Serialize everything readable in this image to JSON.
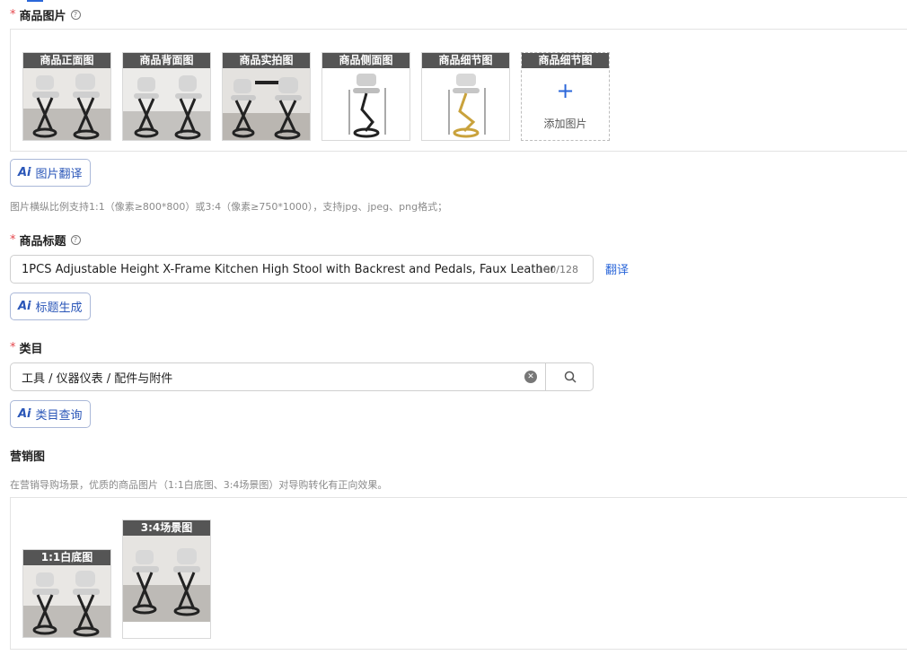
{
  "images_section": {
    "required_mark": "*",
    "label": "商品图片",
    "help_icon": "question-circle-icon",
    "thumbnails": [
      {
        "caption": "商品正面图",
        "style": "scene"
      },
      {
        "caption": "商品背面图",
        "style": "scene"
      },
      {
        "caption": "商品实拍图",
        "style": "scene"
      },
      {
        "caption": "商品侧面图",
        "style": "diagram-black"
      },
      {
        "caption": "商品细节图",
        "style": "diagram-gold"
      }
    ],
    "add_tile": {
      "caption": "商品细节图",
      "icon": "plus-icon",
      "label": "添加图片"
    },
    "ai_button": {
      "ai": "Ai",
      "label": "图片翻译"
    },
    "hint": "图片横纵比例支持1:1（像素≥800*800）或3:4（像素≥750*1000），支持jpg、jpeg、png格式；"
  },
  "title_section": {
    "required_mark": "*",
    "label": "商品标题",
    "help_icon": "question-circle-icon",
    "value": "1PCS Adjustable Height X-Frame Kitchen High Stool with Backrest and Pedals, Faux Leather",
    "count": "100/128",
    "translate_label": "翻译",
    "ai_button": {
      "ai": "Ai",
      "label": "标题生成"
    }
  },
  "category_section": {
    "required_mark": "*",
    "label": "类目",
    "value": "工具 / 仪器仪表 / 配件与附件",
    "clear_icon": "clear-circle-icon",
    "search_icon": "search-icon",
    "ai_button": {
      "ai": "Ai",
      "label": "类目查询"
    }
  },
  "marketing_section": {
    "label": "营销图",
    "hint": "在营销导购场景，优质的商品图片（1:1白底图、3:4场景图）对导购转化有正向效果。",
    "images": [
      {
        "caption": "1:1白底图"
      },
      {
        "caption": "3:4场景图"
      }
    ]
  },
  "colors": {
    "accent": "#2a66d9",
    "required": "#e5484d",
    "caption_bg": "#555555"
  }
}
